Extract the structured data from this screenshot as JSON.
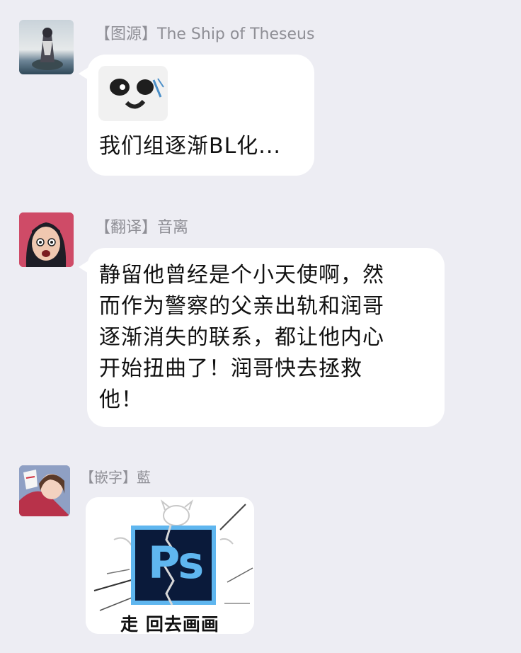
{
  "messages": [
    {
      "sender": "【图源】The Ship of Theseus",
      "text": "我们组逐渐BL化..."
    },
    {
      "sender": "【翻译】音离",
      "lines": [
        "静留他曾经是个小天使啊，然",
        "而作为警察的父亲出轨和润哥",
        "逐渐消失的联系，都让他内心",
        "开始扭曲了！润哥快去拯救",
        "他！"
      ]
    },
    {
      "sender": "【嵌字】藍",
      "sticker": {
        "app_letters": "Ps",
        "caption": "走 回去画画"
      }
    }
  ],
  "colors": {
    "background": "#ededf3",
    "bubble": "#ffffff",
    "ps_dark": "#0a1a3a",
    "ps_light": "#5fb6ef"
  }
}
